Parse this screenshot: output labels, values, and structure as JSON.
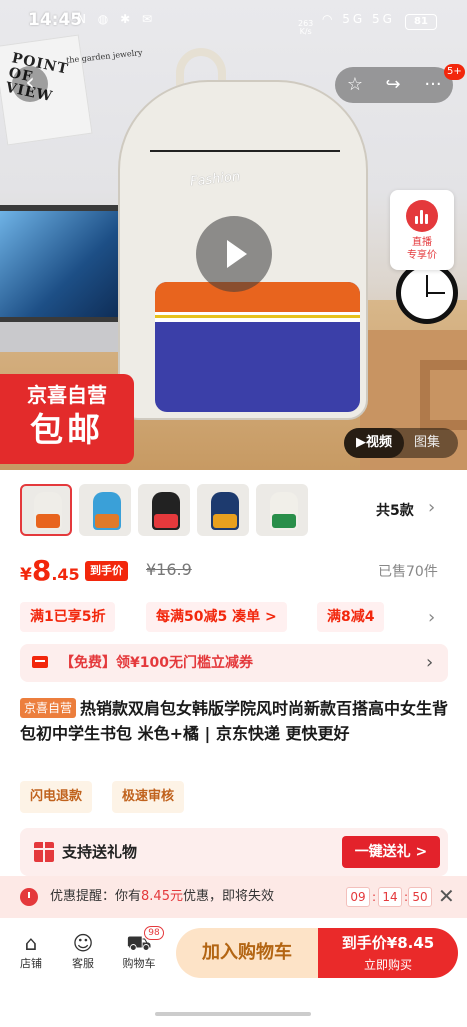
{
  "status_bar": {
    "time": "14:45",
    "left_icons": "N ◍ ✱ ✉",
    "net_speed_value": "263",
    "net_speed_unit": "K/s",
    "right_icons": "◠ 5G 5G",
    "battery": "81"
  },
  "hero": {
    "card_text": "POINT OF VIEW",
    "card_subtext": "the garden jewelry",
    "bag_label": "Fashion",
    "more_badge": "5+",
    "live_label_1": "直播",
    "live_label_2": "专享价",
    "jx_top": "京喜自营",
    "jx_bottom": "包邮",
    "video_label": "▶视频",
    "pics_label": "图集"
  },
  "colors": {
    "accent": "#f2270c",
    "brand_red": "#e4393c",
    "orange": "#ec7e3d"
  },
  "thumbnails": {
    "count_label": "共5款",
    "items": [
      {
        "body": "#efede8",
        "pocket": "#e8641e",
        "selected": true
      },
      {
        "body": "#3aa0d8",
        "pocket": "#e07a2a",
        "selected": false
      },
      {
        "body": "#222222",
        "pocket": "#e4393c",
        "selected": false
      },
      {
        "body": "#1d3a6e",
        "pocket": "#e8a01e",
        "selected": false
      },
      {
        "body": "#f1efe9",
        "pocket": "#2a8f4a",
        "selected": false
      }
    ]
  },
  "price": {
    "currency": "¥",
    "integer": "8",
    "decimal": ".45",
    "tag": "到手价",
    "original": "¥16.9",
    "sold": "已售70件"
  },
  "promos": [
    {
      "label": "满1已享5折"
    },
    {
      "label": "每满50减5 凑单 >"
    },
    {
      "label": "满8减4"
    }
  ],
  "coupon": {
    "text": "【免费】领¥100无门槛立减券"
  },
  "product": {
    "badge": "京喜自营",
    "title": "热销款双肩包女韩版学院风时尚新款百搭高中女生背包初中学生书包 米色+橘 | 京东快递 更快更好",
    "services": [
      "闪电退款",
      "极速审核"
    ]
  },
  "gift": {
    "text": "支持送礼物",
    "button": "一键送礼 >"
  },
  "reminder": {
    "prefix": "优惠提醒：你有",
    "amount": "8.45元",
    "suffix": "优惠，即将失效",
    "countdown": [
      "09",
      "14",
      "50"
    ]
  },
  "bottom_bar": {
    "store": "店铺",
    "service": "客服",
    "cart": "购物车",
    "cart_count": "98",
    "add_cart": "加入购物车",
    "buy_line1": "到手价¥8.45",
    "buy_line2": "立即购买"
  }
}
